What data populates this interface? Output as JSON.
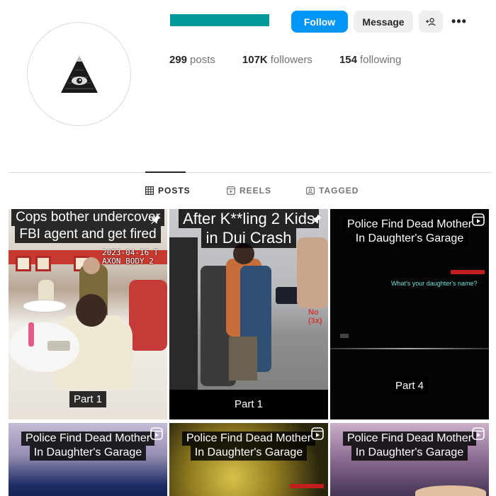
{
  "profile": {
    "follow_label": "Follow",
    "message_label": "Message",
    "more_label": "•••",
    "brand_color": "#00999a"
  },
  "stats": {
    "posts_count": "299",
    "posts_label": "posts",
    "followers_count": "107K",
    "followers_label": "followers",
    "following_count": "154",
    "following_label": "following"
  },
  "tabs": {
    "posts": "POSTS",
    "reels": "REELS",
    "tagged": "TAGGED"
  },
  "posts": [
    {
      "caption": [
        "Cops bother undercover",
        "FBI agent and get fired"
      ],
      "overlay": [
        "2023-04-16  T",
        "AXON BODY 2"
      ],
      "part": "Part 1",
      "pinned": true
    },
    {
      "caption": [
        "After K**ling 2 Kids",
        "in Dui Crash"
      ],
      "overlay": [
        "No (3x)"
      ],
      "part": "Part 1",
      "pinned": true
    },
    {
      "caption": [
        "Police Find Dead Mother",
        "In Daughter's Garage"
      ],
      "subtitle": "What's your daughter's name?",
      "part": "Part 4",
      "reel": true
    },
    {
      "caption": [
        "Police Find Dead Mother",
        "In Daughter's Garage"
      ],
      "reel": true
    },
    {
      "caption": [
        "Police Find Dead Mother",
        "In Daughter's Garage"
      ],
      "reel": true
    },
    {
      "caption": [
        "Police Find Dead Mother",
        "In Daughter's Garage"
      ],
      "reel": true
    }
  ]
}
